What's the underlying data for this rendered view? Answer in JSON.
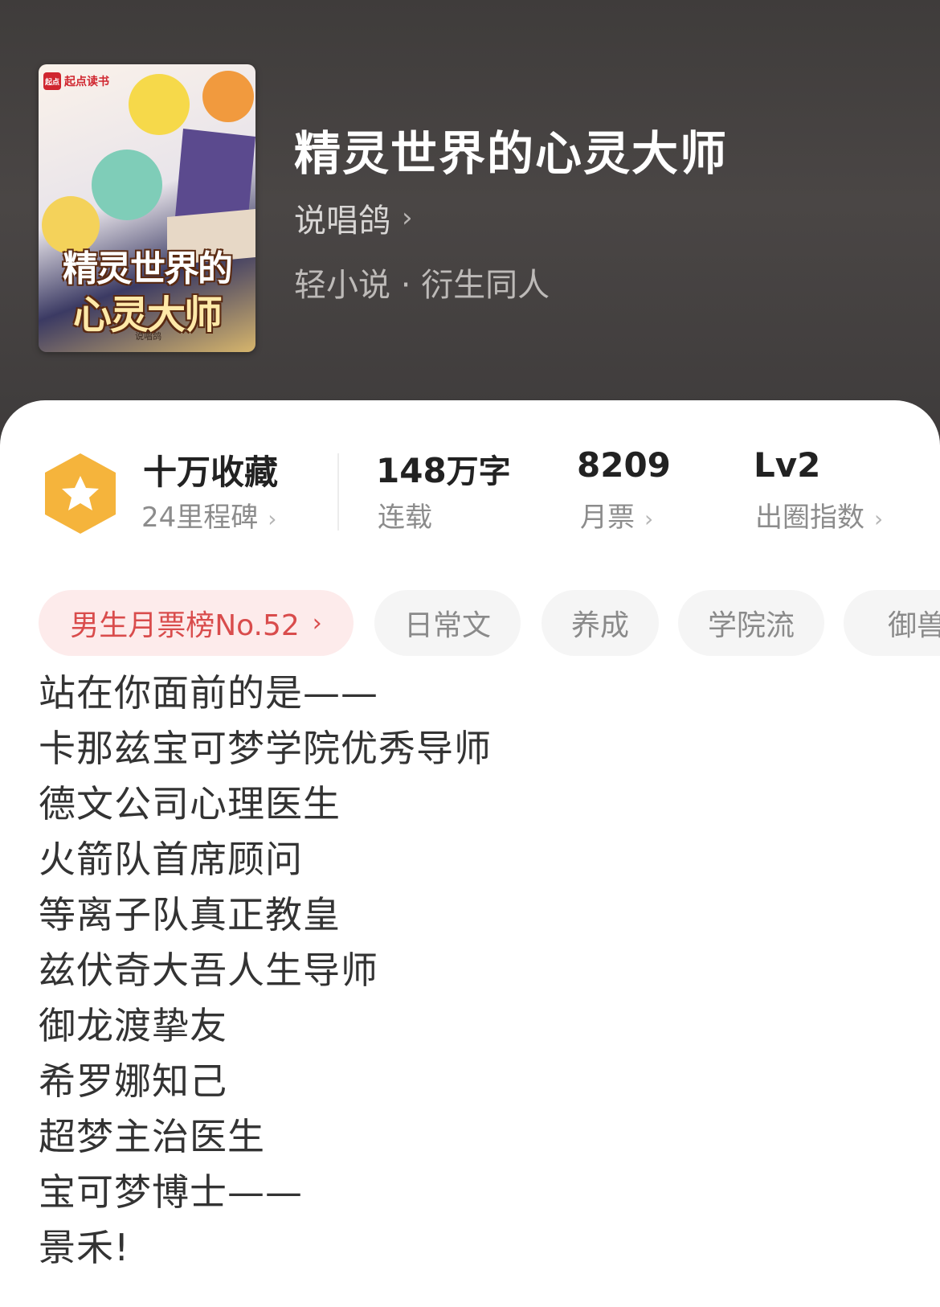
{
  "book": {
    "title": "精灵世界的心灵大师",
    "author": "说唱鸽",
    "genre": "轻小说 · 衍生同人",
    "cover": {
      "badge_logo": "起点",
      "badge_text": "起点读书",
      "title_line1": "精灵世界的",
      "title_line2": "心灵大师",
      "author": "说唱鸽"
    }
  },
  "stats": {
    "collection": {
      "main": "十万收藏",
      "sub": "24里程碑"
    },
    "words": {
      "number": "148",
      "unit": "万字",
      "sub": "连载"
    },
    "monthly_ticket": {
      "main": "8209",
      "sub": "月票"
    },
    "influence": {
      "main": "Lv2",
      "sub": "出圈指数"
    }
  },
  "tags": {
    "rank": "男生月票榜No.52",
    "items": [
      "日常文",
      "养成",
      "学院流",
      "御兽"
    ]
  },
  "intro": [
    "站在你面前的是——",
    "卡那兹宝可梦学院优秀导师",
    "德文公司心理医生",
    "火箭队首席顾问",
    "等离子队真正教皇",
    "兹伏奇大吾人生导师",
    "御龙渡挚友",
    "希罗娜知己",
    "超梦主治医生",
    "宝可梦博士——",
    "景禾!"
  ],
  "icons": {
    "chevron": "chevron-right-icon",
    "milestone": "star-hexagon-icon"
  },
  "colors": {
    "header_bg": "#454141",
    "badge_orange": "#f5b43c",
    "rank_text": "#d94c4c",
    "rank_bg": "#fdebeb"
  }
}
